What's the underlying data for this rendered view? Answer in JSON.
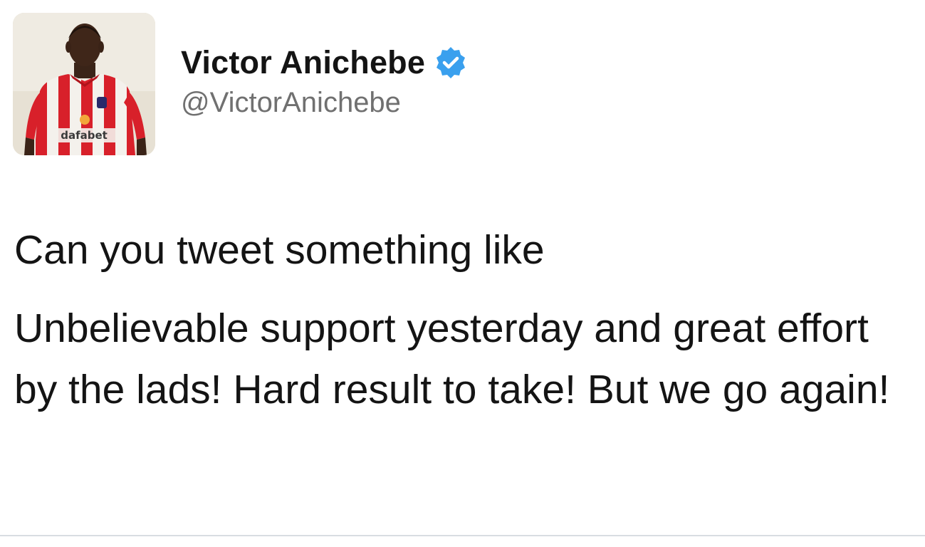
{
  "user": {
    "display_name": "Victor Anichebe",
    "handle": "@VictorAnichebe",
    "verified": true,
    "avatar_sponsor_text": "dafabet"
  },
  "tweet": {
    "paragraphs": [
      "Can you tweet something like",
      "Unbelievable support yesterday and great effort by the lads! Hard result to take! But we go again!"
    ]
  },
  "colors": {
    "verified_badge": "#3aa0ee",
    "handle_text": "#707070",
    "shirt_red": "#d8202a",
    "divider": "#d8dde2"
  },
  "icons": {
    "verified": "verified-badge-icon"
  }
}
